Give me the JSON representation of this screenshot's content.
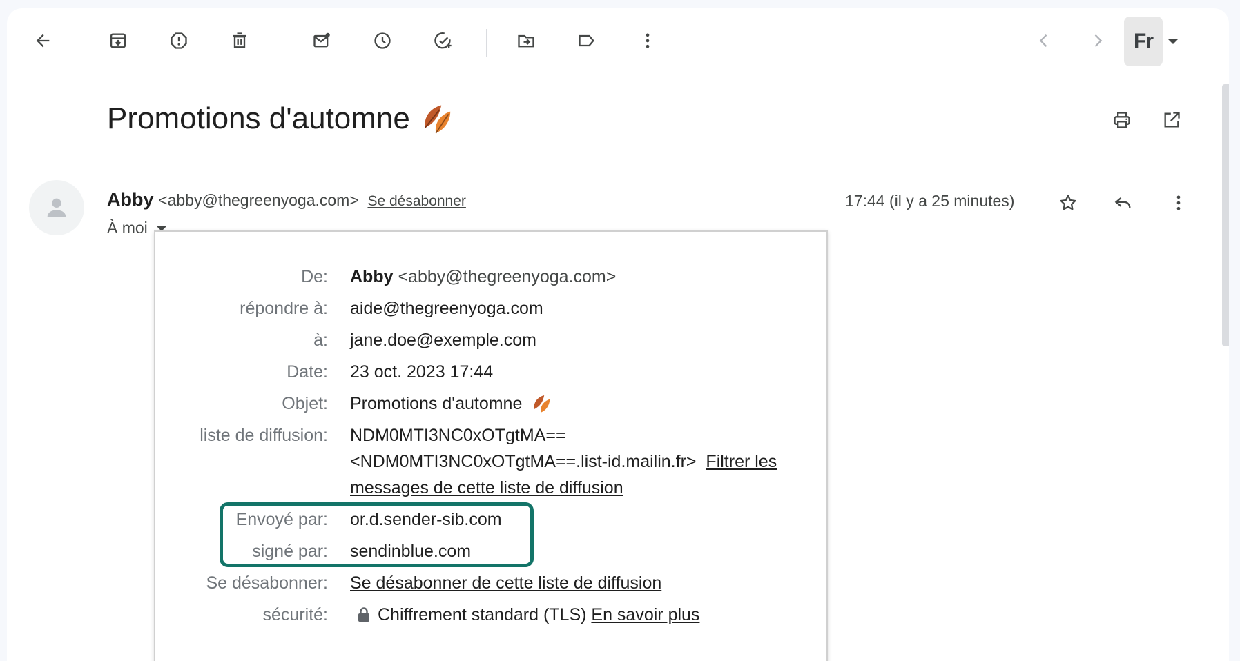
{
  "toolbar": {
    "back": "arrow-left-icon",
    "archive": "archive-icon",
    "report_spam": "report-spam-icon",
    "delete": "trash-icon",
    "mark_unread": "mark-unread-icon",
    "snooze": "clock-icon",
    "add_task": "add-task-icon",
    "move_to": "move-to-icon",
    "label": "label-icon",
    "more": "more-vertical-icon",
    "prev": "chevron-left-icon",
    "next": "chevron-right-icon",
    "language": "Fr"
  },
  "email": {
    "subject": "Promotions d'automne",
    "subject_emoji": "leaves",
    "sender_name": "Abby",
    "sender_email": "<abby@thegreenyoga.com>",
    "unsubscribe": "Se désabonner",
    "to_label": "À moi",
    "time": "17:44 (il y a 25 minutes)"
  },
  "details": {
    "from_label": "De:",
    "from_name": "Abby",
    "from_email": "<abby@thegreenyoga.com>",
    "reply_to_label": "répondre à:",
    "reply_to": "aide@thegreenyoga.com",
    "to_label": "à:",
    "to": "jane.doe@exemple.com",
    "date_label": "Date:",
    "date": "23 oct. 2023 17:44",
    "subject_label": "Objet:",
    "subject": "Promotions d'automne",
    "mailing_list_label": "liste de diffusion:",
    "mailing_list_line1": "NDM0MTI3NC0xOTgtMA==",
    "mailing_list_line2": "<NDM0MTI3NC0xOTgtMA==.list-id.mailin.fr>",
    "filter_link": "Filtrer les messages de cette liste de diffusion",
    "mailed_by_label": "Envoyé par:",
    "mailed_by": "or.d.sender-sib.com",
    "signed_by_label": "signé par:",
    "signed_by": "sendinblue.com",
    "unsubscribe_label": "Se désabonner:",
    "unsubscribe_link": "Se désabonner de cette liste de diffusion",
    "security_label": "sécurité:",
    "security_value": "Chiffrement standard (TLS)",
    "learn_more": "En savoir plus"
  },
  "colors": {
    "highlight": "#137468",
    "label_gray": "#70757a"
  }
}
